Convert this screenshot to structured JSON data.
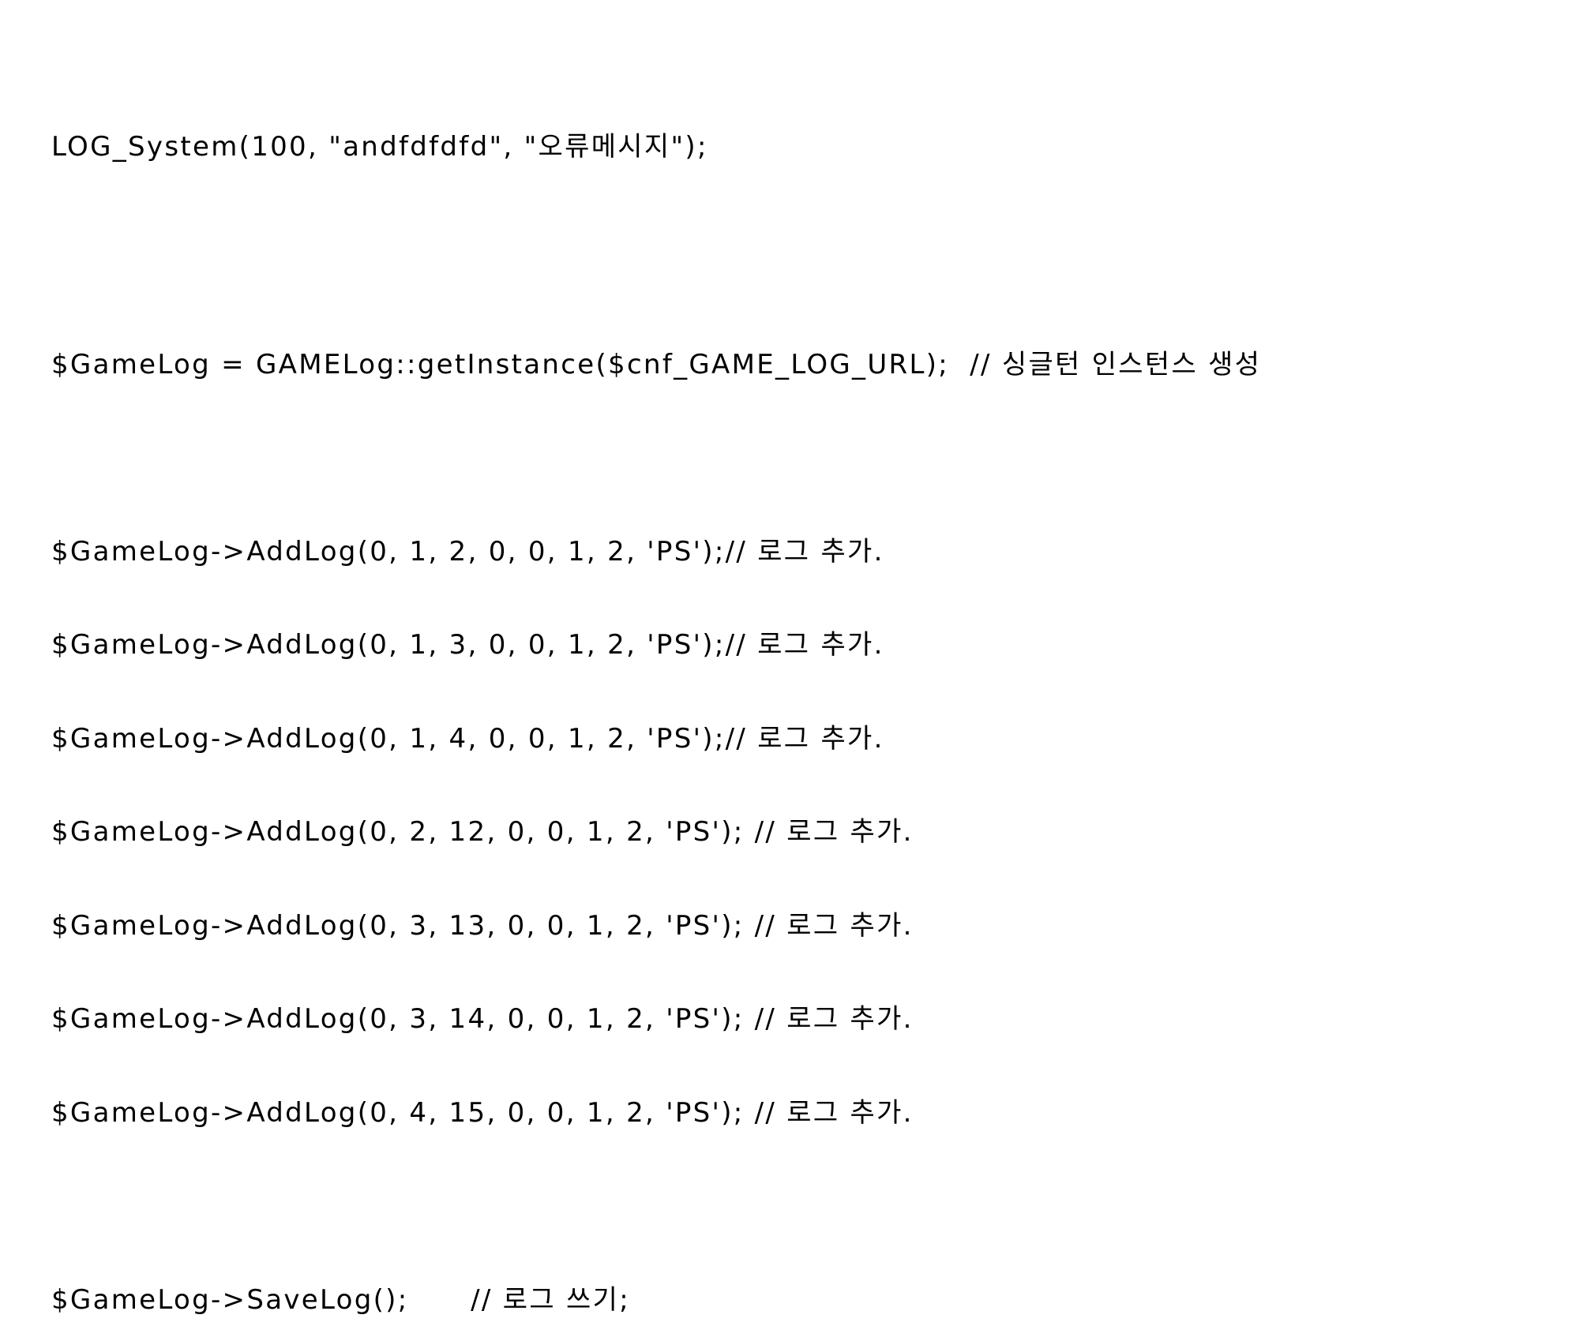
{
  "lines": {
    "log_system": "LOG_System(100, \"andfdfdfd\", \"오류메시지\");",
    "get_instance": "$GameLog = GAMELog::getInstance($cnf_GAME_LOG_URL);  // 싱글턴 인스턴스 생성",
    "add_log_1": "$GameLog->AddLog(0, 1, 2, 0, 0, 1, 2, 'PS');// 로그 추가.",
    "add_log_2": "$GameLog->AddLog(0, 1, 3, 0, 0, 1, 2, 'PS');// 로그 추가.",
    "add_log_3": "$GameLog->AddLog(0, 1, 4, 0, 0, 1, 2, 'PS');// 로그 추가.",
    "add_log_4": "$GameLog->AddLog(0, 2, 12, 0, 0, 1, 2, 'PS'); // 로그 추가.",
    "add_log_5": "$GameLog->AddLog(0, 3, 13, 0, 0, 1, 2, 'PS'); // 로그 추가.",
    "add_log_6": "$GameLog->AddLog(0, 3, 14, 0, 0, 1, 2, 'PS'); // 로그 추가.",
    "add_log_7": "$GameLog->AddLog(0, 4, 15, 0, 0, 1, 2, 'PS'); // 로그 추가.",
    "save_log": "$GameLog->SaveLog();      // 로그 쓰기;"
  }
}
